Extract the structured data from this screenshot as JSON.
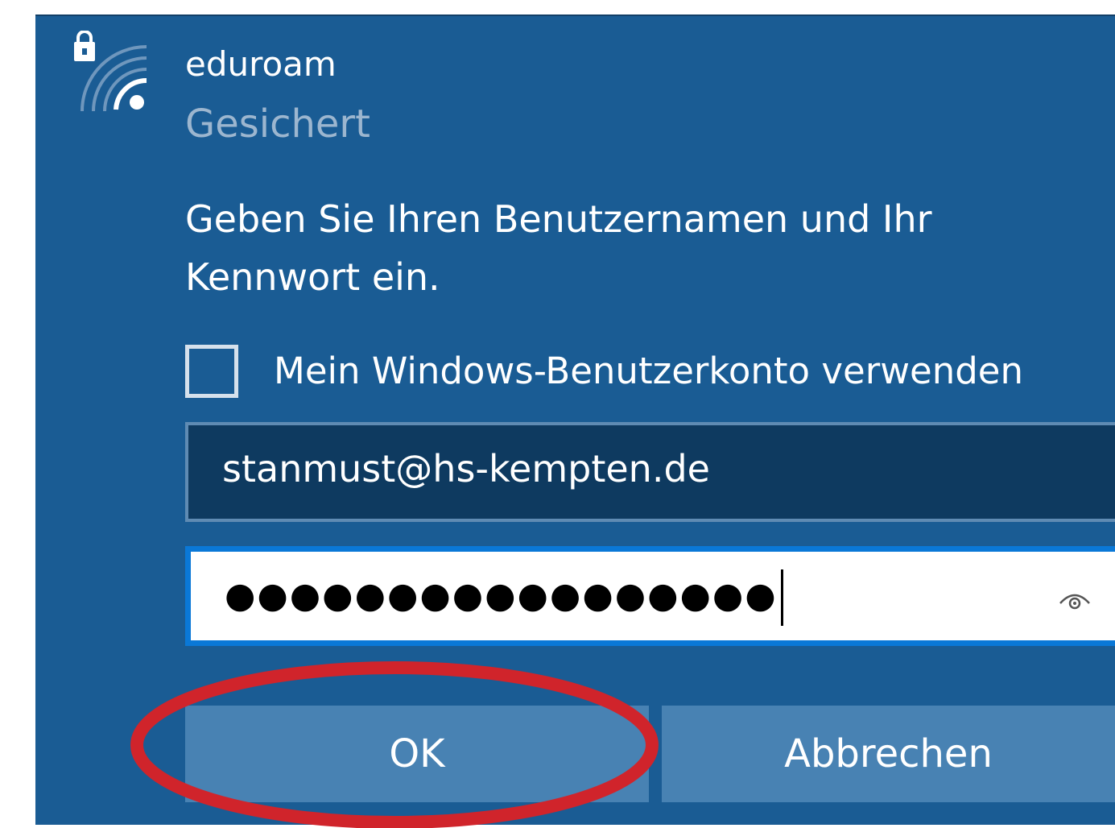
{
  "network": {
    "name": "eduroam",
    "status": "Gesichert",
    "icon": "wifi-secured-icon"
  },
  "prompt": "Geben Sie Ihren Benutzernamen und Ihr Kennwort ein.",
  "use_windows_account": {
    "label": "Mein Windows-Benutzerkonto verwenden",
    "checked": false
  },
  "username": {
    "value": "stanmust@hs-kempten.de"
  },
  "password": {
    "masked": "●●●●●●●●●●●●●●●●●",
    "reveal_icon": "eye-icon"
  },
  "buttons": {
    "ok": "OK",
    "cancel": "Abbrechen"
  },
  "annotation": {
    "color": "#d0242b",
    "target": "ok-button"
  },
  "colors": {
    "panel": "#1a5c94",
    "button": "#4882b3",
    "focus_border": "#0a78d7"
  }
}
